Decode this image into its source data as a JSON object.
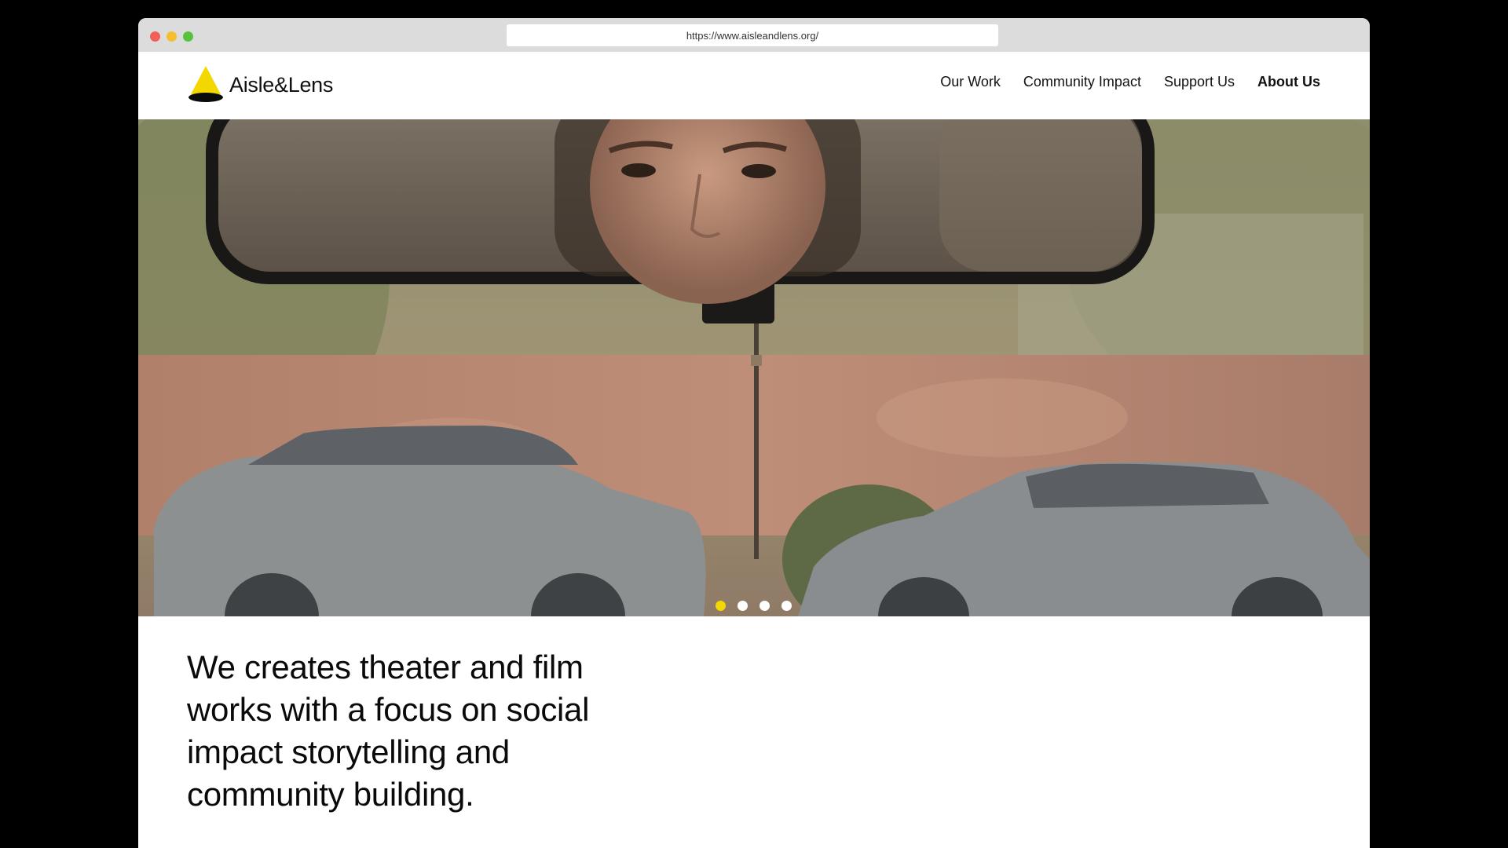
{
  "browser": {
    "url": "https://www.aisleandlens.org/"
  },
  "site": {
    "logo_text": "Aisle&Lens",
    "brand_color": "#f2d800"
  },
  "nav": {
    "items": [
      {
        "label": "Our Work",
        "active": false
      },
      {
        "label": "Community Impact",
        "active": false
      },
      {
        "label": "Support Us",
        "active": false
      },
      {
        "label": "About Us",
        "active": true
      }
    ]
  },
  "hero": {
    "slide_count": 4,
    "active_slide": 1
  },
  "intro": {
    "headline": "We creates theater and film works with a focus on social impact storytelling and community building."
  }
}
